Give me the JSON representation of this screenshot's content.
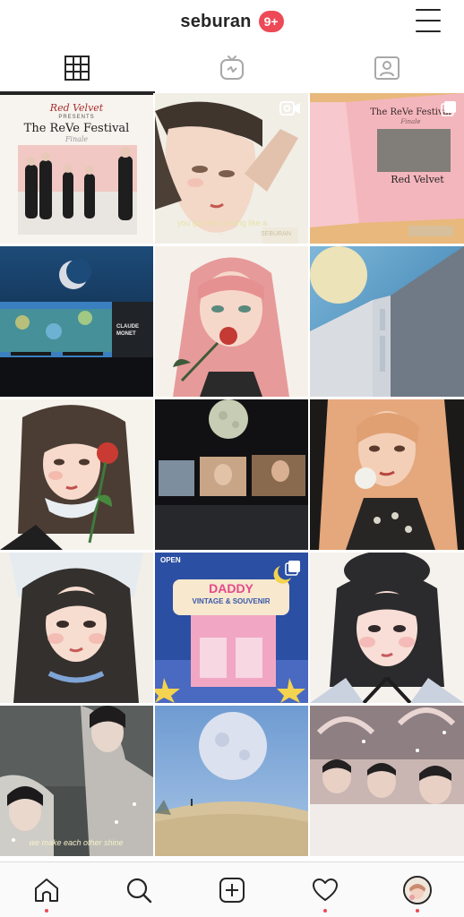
{
  "header": {
    "username": "seburan",
    "notification_badge": "9+",
    "menu_icon": "hamburger-menu-icon"
  },
  "tabs": [
    {
      "name": "grid",
      "icon": "grid-icon",
      "active": true
    },
    {
      "name": "igtv",
      "icon": "igtv-icon",
      "active": false
    },
    {
      "name": "tagged",
      "icon": "tagged-person-icon",
      "active": false
    }
  ],
  "posts": [
    {
      "id": 1,
      "title_top": "Red Velvet",
      "title_mid": "PRESENTS",
      "title_main": "The ReVe Festival",
      "title_sub": "Finale"
    },
    {
      "id": 2,
      "badge": "video-icon",
      "caption": "you got me running like a ...",
      "signature": "SEBURAN"
    },
    {
      "id": 3,
      "badge": "multiple-icon",
      "box_title": "The ReVe Festival",
      "box_sub": "Finale",
      "box_brand": "Red Velvet"
    },
    {
      "id": 4,
      "sign_title": "CLAUDE MONET"
    },
    {
      "id": 5
    },
    {
      "id": 6
    },
    {
      "id": 7
    },
    {
      "id": 8
    },
    {
      "id": 9
    },
    {
      "id": 10
    },
    {
      "id": 11,
      "badge": "multiple-icon",
      "sign_open": "OPEN",
      "sign_brand": "DADDY",
      "sign_line": "VINTAGE & SOUVENIR"
    },
    {
      "id": 12
    },
    {
      "id": 13,
      "caption": "we make each other shine"
    },
    {
      "id": 14
    },
    {
      "id": 15
    }
  ],
  "bottom_nav": [
    {
      "name": "home",
      "icon": "home-icon",
      "dot": true
    },
    {
      "name": "search",
      "icon": "search-icon",
      "dot": false
    },
    {
      "name": "new-post",
      "icon": "add-post-icon",
      "dot": false
    },
    {
      "name": "activity",
      "icon": "heart-icon",
      "dot": true
    },
    {
      "name": "profile",
      "icon": "profile-avatar",
      "dot": true
    }
  ],
  "colors": {
    "accent_red": "#ed4956",
    "text": "#262626",
    "border": "#dbdbdb"
  }
}
